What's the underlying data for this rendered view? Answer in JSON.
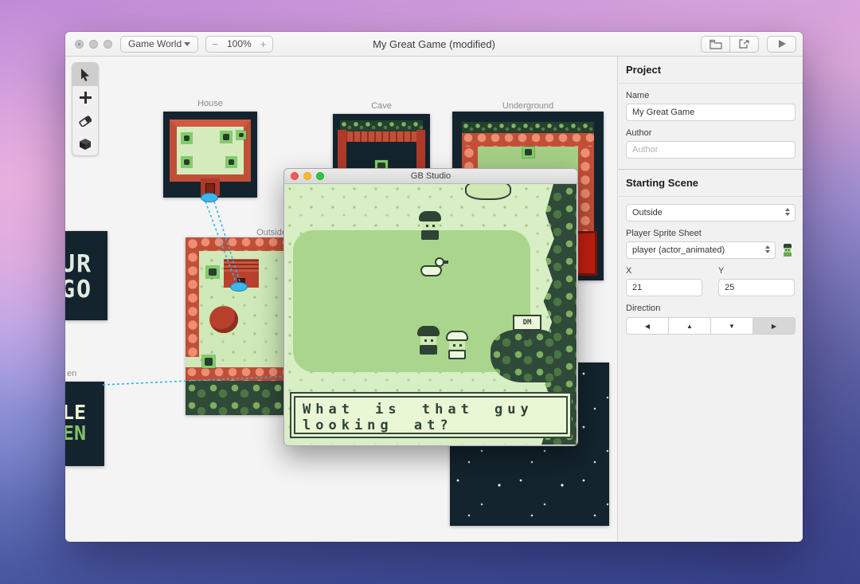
{
  "app": {
    "toolbar": {
      "scene_selector": "Game World",
      "zoom_out": "−",
      "zoom_level": "100%",
      "zoom_in": "+",
      "title": "My Great Game (modified)"
    },
    "tool_icons": [
      "select-cursor-icon",
      "add-icon",
      "eraser-icon",
      "collisions-cube-icon"
    ],
    "toolbar_icons": [
      "folder-icon",
      "export-icon",
      "play-icon"
    ]
  },
  "canvas": {
    "scene_labels": {
      "house": "House",
      "cave": "Cave",
      "underground": "Underground",
      "outside": "Outside",
      "title_fragment": "en"
    },
    "logo_scene_text": [
      "UR",
      "GO"
    ],
    "title_scene_text": [
      "LE",
      "EN"
    ]
  },
  "game_window": {
    "title": "GB Studio",
    "dialogue": [
      "What is that guy",
      "looking at?"
    ],
    "sign_text": "DM"
  },
  "sidebar": {
    "project": {
      "heading": "Project",
      "name_label": "Name",
      "name_value": "My Great Game",
      "author_label": "Author",
      "author_placeholder": "Author"
    },
    "starting_scene": {
      "heading": "Starting Scene",
      "scene_value": "Outside",
      "sprite_label": "Player Sprite Sheet",
      "sprite_value": "player (actor_animated)",
      "x_label": "X",
      "x_value": "21",
      "y_label": "Y",
      "y_value": "25",
      "direction_label": "Direction",
      "direction_options": [
        "◀",
        "▲",
        "▼",
        "▶"
      ],
      "direction_selected": "▶"
    }
  },
  "colors": {
    "connection_blue": "#2fb6e8",
    "scene_dark": "#13242f",
    "scene_red": "#c14f38",
    "gb_light": "#d8eec4",
    "gb_mid": "#a9d68c",
    "gb_dark": "#2e4434"
  }
}
